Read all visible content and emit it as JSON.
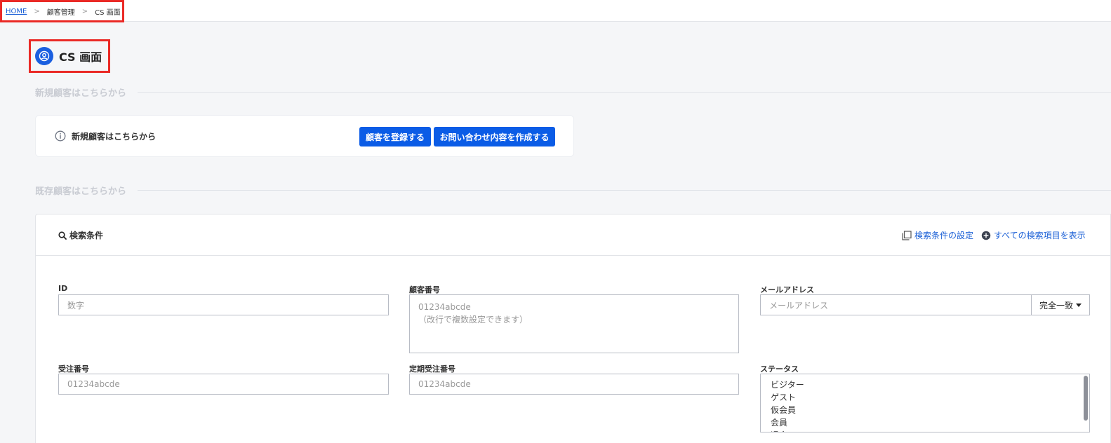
{
  "breadcrumb": {
    "home": "HOME",
    "sep": ">",
    "customer_mgmt": "顧客管理",
    "current": "CS 画面"
  },
  "page": {
    "title": "CS 画面",
    "icon": "user-circle-icon"
  },
  "new_section": {
    "heading": "新規顧客はこちらから",
    "card_label": "新規顧客はこちらから",
    "register_button": "顧客を登録する",
    "inquiry_button": "お問い合わせ内容を作成する"
  },
  "existing_section": {
    "heading": "既存顧客はこちらから"
  },
  "search": {
    "title": "検索条件",
    "settings_link": "検索条件の設定",
    "show_all_link": "すべての検索項目を表示",
    "fields": {
      "id": {
        "label": "ID",
        "placeholder": "数字"
      },
      "customer_number": {
        "label": "顧客番号",
        "placeholder": "01234abcde\n（改行で複数設定できます）"
      },
      "email": {
        "label": "メールアドレス",
        "placeholder": "メールアドレス",
        "match": "完全一致"
      },
      "order_number": {
        "label": "受注番号",
        "placeholder": "01234abcde"
      },
      "subscription_order_number": {
        "label": "定期受注番号",
        "placeholder": "01234abcde"
      },
      "status": {
        "label": "ステータス",
        "options": [
          "ビジター",
          "ゲスト",
          "仮会員",
          "会員",
          "退会"
        ]
      }
    }
  },
  "colors": {
    "accent": "#0b5ce6",
    "link": "#1a5fd6",
    "highlight_border": "#ea2a26"
  }
}
